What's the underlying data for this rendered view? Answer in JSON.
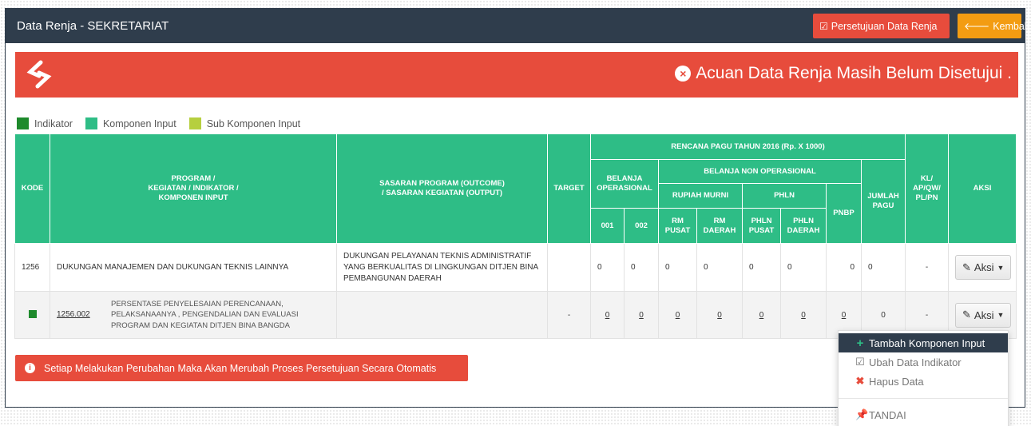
{
  "header": {
    "title": "Data Renja - SEKRETARIAT",
    "approve_label": "Persetujuan Data Renja",
    "back_label": "Kembali",
    "colors": {
      "header_bg": "#2f3d4c",
      "approve": "#e74c3c",
      "back": "#f39c12"
    }
  },
  "alert": {
    "message": "Acuan Data Renja Masih Belum Disetujui .",
    "color": "#e74c3c"
  },
  "legend": [
    {
      "label": "Indikator",
      "color": "#1e8a2c"
    },
    {
      "label": "Komponen Input",
      "color": "#2ebd86"
    },
    {
      "label": "Sub Komponen Input",
      "color": "#b6cf3f"
    }
  ],
  "table": {
    "headers": {
      "kode": "KODE",
      "program_1": "PROGRAM /",
      "program_2": "KEGIATAN / INDIKATOR /",
      "program_3": "KOMPONEN INPUT",
      "sasaran_1": "SASARAN PROGRAM (OUTCOME)",
      "sasaran_2": "/ SASARAN KEGIATAN (OUTPUT)",
      "target": "TARGET",
      "rencana": "RENCANA PAGU TAHUN 2016 (Rp. X 1000)",
      "belanja_op_1": "BELANJA",
      "belanja_op_2": "OPERASIONAL",
      "belanja_non_op": "BELANJA NON OPERASIONAL",
      "rupiah_murni": "RUPIAH MURNI",
      "phln": "PHLN",
      "pnbp": "PNBP",
      "jumlah_1": "JUMLAH",
      "jumlah_2": "PAGU",
      "kl_1": "KL/",
      "kl_2": "AP/QW/",
      "kl_3": "PL/PN",
      "aksi": "AKSI",
      "c001": "001",
      "c002": "002",
      "rm_pusat_1": "RM",
      "rm_pusat_2": "PUSAT",
      "rm_daerah_1": "RM",
      "rm_daerah_2": "DAERAH",
      "phln_pusat_1": "PHLN",
      "phln_pusat_2": "PUSAT",
      "phln_daerah_1": "PHLN",
      "phln_daerah_2": "DAERAH"
    },
    "rows": [
      {
        "kode": "1256",
        "program": "DUKUNGAN MANAJEMEN DAN DUKUNGAN TEKNIS LAINNYA",
        "sasaran": "DUKUNGAN PELAYANAN TEKNIS ADMINISTRATIF YANG BERKUALITAS DI LINGKUNGAN DITJEN BINA PEMBANGUNAN DAERAH",
        "target": "",
        "values": [
          "0",
          "0",
          "0",
          "0",
          "0",
          "0",
          "0",
          "0"
        ],
        "kl": "-",
        "aksi": "Aksi"
      },
      {
        "kode": "1256.002",
        "program": "PERSENTASE PENYELESAIAN PERENCANAAN, PELAKSANAANYA , PENGENDALIAN DAN EVALUASI PROGRAM DAN KEGIATAN DITJEN BINA BANGDA",
        "target": "-",
        "values": [
          "0",
          "0",
          "0",
          "0",
          "0",
          "0",
          "0",
          "0"
        ],
        "kl": "-",
        "aksi": "Aksi"
      }
    ]
  },
  "warning": "Setiap Melakukan Perubahan Maka Akan Merubah Proses Persetujuan Secara Otomatis",
  "dropdown": {
    "items": [
      {
        "label": "Tambah Komponen Input",
        "icon": "plus-icon"
      },
      {
        "label": "Ubah Data Indikator",
        "icon": "edit-icon"
      },
      {
        "label": "Hapus Data",
        "icon": "times-icon"
      },
      {
        "label": "TANDAI",
        "icon": "pin-icon"
      }
    ]
  }
}
